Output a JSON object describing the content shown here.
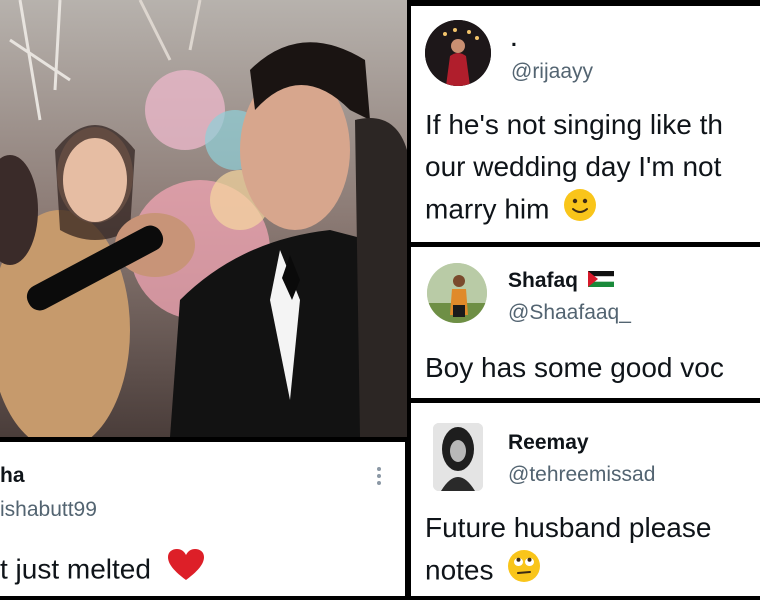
{
  "tweets": [
    {
      "name": ".",
      "handle": "@rijaayy",
      "line1": "If he's not singing like th",
      "line2": "our wedding day I'm not",
      "line3": "marry him",
      "emoji": "slightly-smiling-face"
    },
    {
      "name": "Shafaq",
      "flag": "palestine-flag",
      "handle": "@Shaafaaq_",
      "line1": "Boy has some good voc"
    },
    {
      "name": "Reemay",
      "handle": "@tehreemissad",
      "line1": "Future husband please",
      "line2": "notes",
      "emoji": "face-with-rolling-eyes"
    },
    {
      "name": "ha",
      "handle": "ishabutt99",
      "line1": "t just melted",
      "emoji": "red-heart",
      "more": "⋮"
    }
  ],
  "colors": {
    "separator": "#000000",
    "text": "#0f1419",
    "handle": "#536471",
    "heart": "#dd1f28",
    "emoji_yellow": "#f9c51a"
  }
}
